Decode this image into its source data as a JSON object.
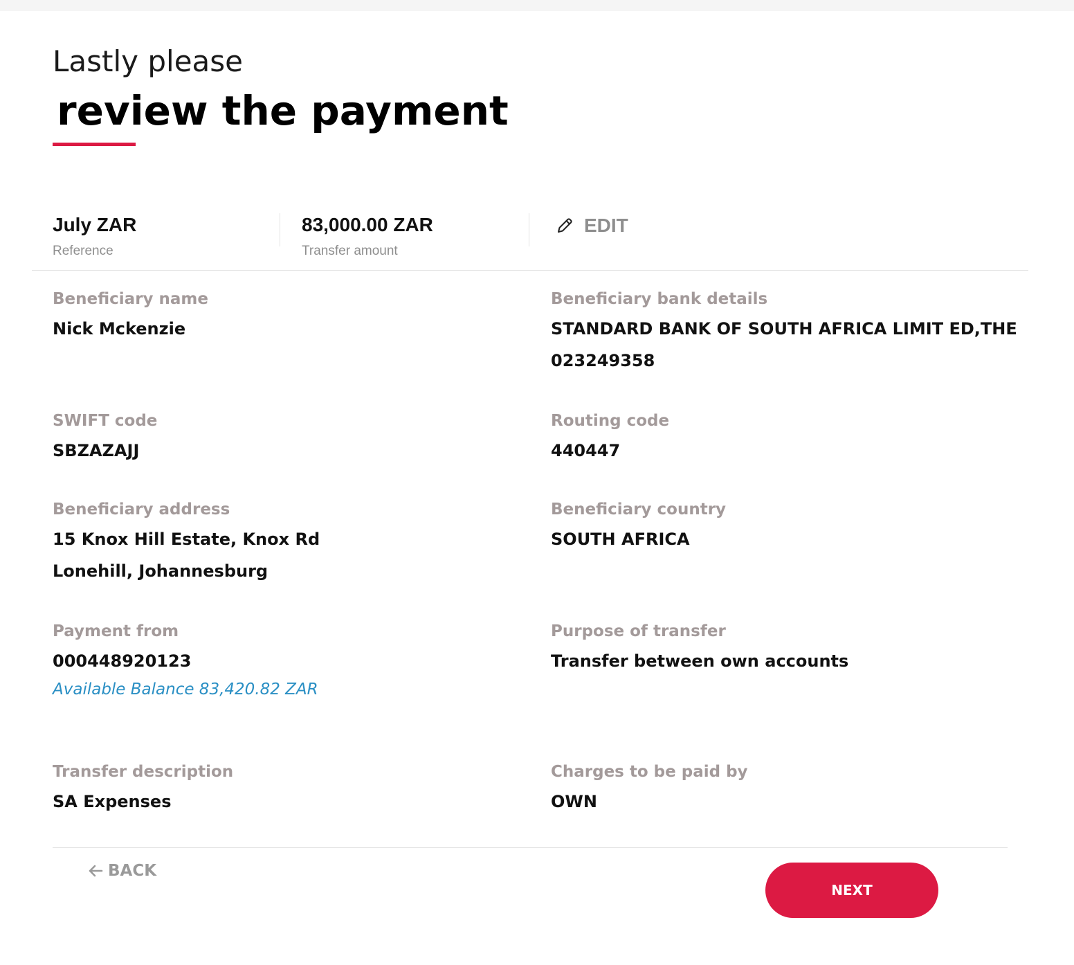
{
  "header": {
    "subtitle": "Lastly please",
    "title": "review the payment"
  },
  "summary": {
    "reference_value": "July ZAR",
    "reference_label": "Reference",
    "amount_value": "83,000.00 ZAR",
    "amount_label": "Transfer amount",
    "edit_label": "EDIT"
  },
  "fields": {
    "beneficiary_name": {
      "label": "Beneficiary name",
      "value": "Nick Mckenzie"
    },
    "bank_details": {
      "label": "Beneficiary bank details",
      "line1": "STANDARD BANK OF SOUTH AFRICA LIMIT ED,THE",
      "line2": "023249358"
    },
    "swift_code": {
      "label": "SWIFT code",
      "value": "SBZAZAJJ"
    },
    "routing_code": {
      "label": "Routing code",
      "value": "440447"
    },
    "beneficiary_address": {
      "label": "Beneficiary address",
      "line1": "15 Knox Hill Estate, Knox Rd",
      "line2": "Lonehill, Johannesburg"
    },
    "beneficiary_country": {
      "label": "Beneficiary country",
      "value": "SOUTH AFRICA"
    },
    "payment_from": {
      "label": "Payment from",
      "value": "000448920123",
      "balance": "Available Balance 83,420.82 ZAR"
    },
    "purpose": {
      "label": "Purpose of transfer",
      "value": "Transfer between own accounts"
    },
    "description": {
      "label": "Transfer description",
      "value": "SA Expenses"
    },
    "charges": {
      "label": "Charges to be paid by",
      "value": "OWN"
    }
  },
  "footer": {
    "back_label": "BACK",
    "next_label": "NEXT"
  },
  "colors": {
    "accent": "#dc1a43",
    "label_gray": "#a39a9a",
    "link_blue": "#2a8fc4"
  },
  "icons": {
    "edit": "pencil-icon",
    "back": "arrow-left-icon"
  }
}
